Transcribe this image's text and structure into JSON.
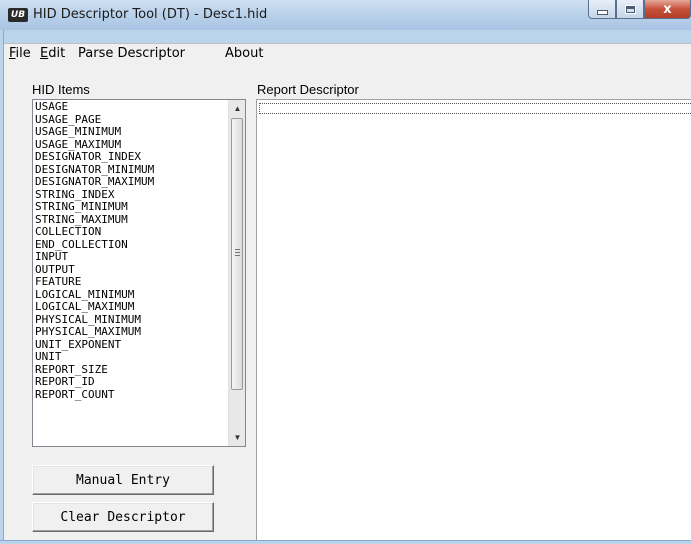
{
  "window": {
    "title": "HID Descriptor Tool (DT) - Desc1.hid",
    "app_icon_text": "UB",
    "close_glyph": "x"
  },
  "menu": {
    "file": {
      "accel": "F",
      "rest": "ile"
    },
    "edit": {
      "accel": "E",
      "rest": "dit"
    },
    "parse": "Parse Descriptor",
    "about": "About"
  },
  "hid_items": {
    "label": "HID Items",
    "items": [
      "USAGE",
      "USAGE_PAGE",
      "USAGE_MINIMUM",
      "USAGE_MAXIMUM",
      "DESIGNATOR_INDEX",
      "DESIGNATOR_MINIMUM",
      "DESIGNATOR_MAXIMUM",
      "STRING_INDEX",
      "STRING_MINIMUM",
      "STRING_MAXIMUM",
      "COLLECTION",
      "END_COLLECTION",
      "INPUT",
      "OUTPUT",
      "FEATURE",
      "LOGICAL_MINIMUM",
      "LOGICAL_MAXIMUM",
      "PHYSICAL_MINIMUM",
      "PHYSICAL_MAXIMUM",
      "UNIT_EXPONENT",
      "UNIT",
      "REPORT_SIZE",
      "REPORT_ID",
      "REPORT_COUNT"
    ]
  },
  "report": {
    "label": "Report Descriptor"
  },
  "buttons": {
    "manual_entry": "Manual Entry",
    "clear_descriptor": "Clear Descriptor"
  }
}
